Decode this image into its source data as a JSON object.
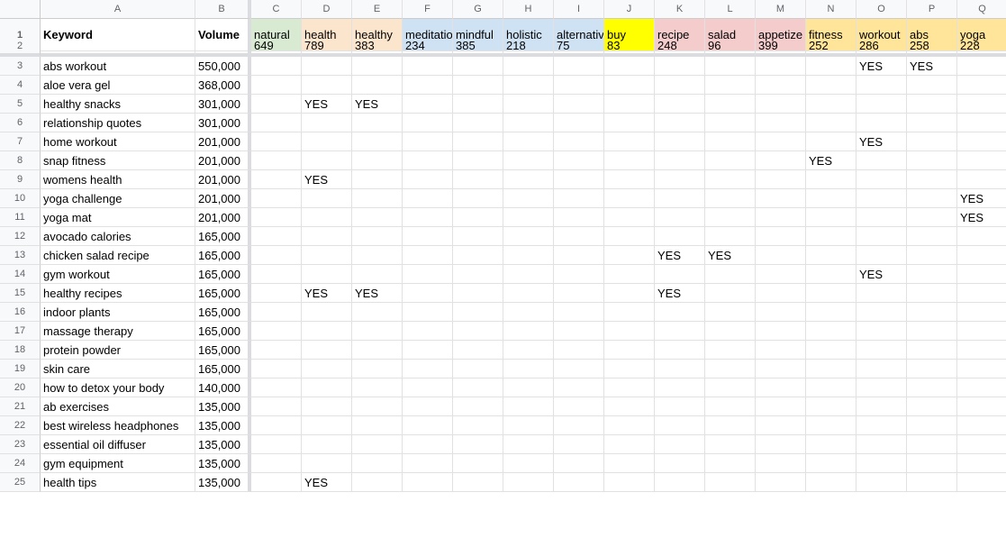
{
  "colHeaders": [
    "",
    "A",
    "B",
    "C",
    "D",
    "E",
    "F",
    "G",
    "H",
    "I",
    "J",
    "K",
    "L",
    "M",
    "N",
    "O",
    "P",
    "Q"
  ],
  "row1": {
    "A": "Keyword",
    "B": "Volume",
    "targets": [
      {
        "label": "natural",
        "cls": "green"
      },
      {
        "label": "health",
        "cls": "orange"
      },
      {
        "label": "healthy",
        "cls": "orange"
      },
      {
        "label": "meditatio",
        "cls": "blue"
      },
      {
        "label": "mindful",
        "cls": "blue"
      },
      {
        "label": "holistic",
        "cls": "blue"
      },
      {
        "label": "alternativ",
        "cls": "blue"
      },
      {
        "label": "buy",
        "cls": "yellow"
      },
      {
        "label": "recipe",
        "cls": "red"
      },
      {
        "label": "salad",
        "cls": "red"
      },
      {
        "label": "appetize",
        "cls": "red"
      },
      {
        "label": "fitness",
        "cls": "tan"
      },
      {
        "label": "workout",
        "cls": "tan"
      },
      {
        "label": "abs",
        "cls": "tan"
      },
      {
        "label": "yoga",
        "cls": "tan"
      }
    ]
  },
  "row2": [
    "649",
    "789",
    "383",
    "234",
    "385",
    "218",
    "75",
    "83",
    "248",
    "96",
    "399",
    "252",
    "286",
    "258",
    "228"
  ],
  "rows": [
    {
      "n": 3,
      "kw": "abs workout",
      "vol": "550,000",
      "y": {
        "O": "YES",
        "P": "YES"
      }
    },
    {
      "n": 4,
      "kw": "aloe vera gel",
      "vol": "368,000",
      "y": {}
    },
    {
      "n": 5,
      "kw": "healthy snacks",
      "vol": "301,000",
      "y": {
        "D": "YES",
        "E": "YES"
      }
    },
    {
      "n": 6,
      "kw": "relationship quotes",
      "vol": "301,000",
      "y": {}
    },
    {
      "n": 7,
      "kw": "home workout",
      "vol": "201,000",
      "y": {
        "O": "YES"
      }
    },
    {
      "n": 8,
      "kw": "snap fitness",
      "vol": "201,000",
      "y": {
        "N": "YES"
      }
    },
    {
      "n": 9,
      "kw": "womens health",
      "vol": "201,000",
      "y": {
        "D": "YES"
      }
    },
    {
      "n": 10,
      "kw": "yoga challenge",
      "vol": "201,000",
      "y": {
        "Q": "YES"
      }
    },
    {
      "n": 11,
      "kw": "yoga mat",
      "vol": "201,000",
      "y": {
        "Q": "YES"
      }
    },
    {
      "n": 12,
      "kw": "avocado calories",
      "vol": "165,000",
      "y": {}
    },
    {
      "n": 13,
      "kw": "chicken salad recipe",
      "vol": "165,000",
      "y": {
        "K": "YES",
        "L": "YES"
      }
    },
    {
      "n": 14,
      "kw": "gym workout",
      "vol": "165,000",
      "y": {
        "O": "YES"
      }
    },
    {
      "n": 15,
      "kw": "healthy recipes",
      "vol": "165,000",
      "y": {
        "D": "YES",
        "E": "YES",
        "K": "YES"
      }
    },
    {
      "n": 16,
      "kw": "indoor plants",
      "vol": "165,000",
      "y": {}
    },
    {
      "n": 17,
      "kw": "massage therapy",
      "vol": "165,000",
      "y": {}
    },
    {
      "n": 18,
      "kw": "protein powder",
      "vol": "165,000",
      "y": {}
    },
    {
      "n": 19,
      "kw": "skin care",
      "vol": "165,000",
      "y": {}
    },
    {
      "n": 20,
      "kw": "how to detox your body",
      "vol": "140,000",
      "y": {}
    },
    {
      "n": 21,
      "kw": "ab exercises",
      "vol": "135,000",
      "y": {}
    },
    {
      "n": 22,
      "kw": "best wireless headphones",
      "vol": "135,000",
      "y": {}
    },
    {
      "n": 23,
      "kw": "essential oil diffuser",
      "vol": "135,000",
      "y": {}
    },
    {
      "n": 24,
      "kw": "gym equipment",
      "vol": "135,000",
      "y": {}
    },
    {
      "n": 25,
      "kw": "health tips",
      "vol": "135,000",
      "y": {
        "D": "YES"
      }
    }
  ]
}
